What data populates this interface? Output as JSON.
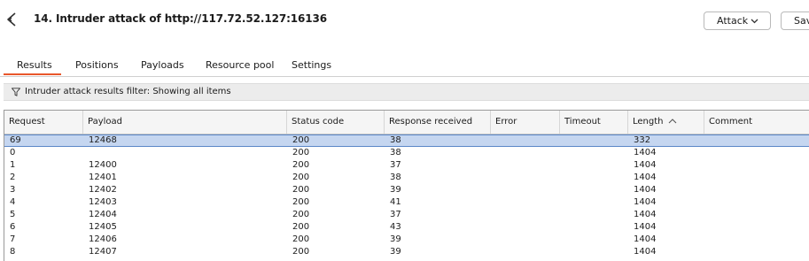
{
  "window": {
    "title": "14. Intruder attack of http://117.72.52.127:16136"
  },
  "toolbar": {
    "attack_label": "Attack",
    "save_label": "Sav"
  },
  "tabs": [
    {
      "label": "Results",
      "active": true
    },
    {
      "label": "Positions"
    },
    {
      "label": "Payloads"
    },
    {
      "label": "Resource pool"
    },
    {
      "label": "Settings"
    }
  ],
  "filter": {
    "text": "Intruder attack results filter: Showing all items"
  },
  "table": {
    "columns": [
      "Request",
      "Payload",
      "Status code",
      "Response received",
      "Error",
      "Timeout",
      "Length",
      "Comment"
    ],
    "sorted_column": "Length",
    "rows": [
      {
        "request": "69",
        "payload": "12468",
        "status": "200",
        "received": "38",
        "error": "",
        "timeout": "",
        "length": "332",
        "comment": "",
        "selected": true
      },
      {
        "request": "0",
        "payload": "",
        "status": "200",
        "received": "38",
        "error": "",
        "timeout": "",
        "length": "1404",
        "comment": ""
      },
      {
        "request": "1",
        "payload": "12400",
        "status": "200",
        "received": "37",
        "error": "",
        "timeout": "",
        "length": "1404",
        "comment": ""
      },
      {
        "request": "2",
        "payload": "12401",
        "status": "200",
        "received": "38",
        "error": "",
        "timeout": "",
        "length": "1404",
        "comment": ""
      },
      {
        "request": "3",
        "payload": "12402",
        "status": "200",
        "received": "39",
        "error": "",
        "timeout": "",
        "length": "1404",
        "comment": ""
      },
      {
        "request": "4",
        "payload": "12403",
        "status": "200",
        "received": "41",
        "error": "",
        "timeout": "",
        "length": "1404",
        "comment": ""
      },
      {
        "request": "5",
        "payload": "12404",
        "status": "200",
        "received": "37",
        "error": "",
        "timeout": "",
        "length": "1404",
        "comment": ""
      },
      {
        "request": "6",
        "payload": "12405",
        "status": "200",
        "received": "43",
        "error": "",
        "timeout": "",
        "length": "1404",
        "comment": ""
      },
      {
        "request": "7",
        "payload": "12406",
        "status": "200",
        "received": "39",
        "error": "",
        "timeout": "",
        "length": "1404",
        "comment": ""
      },
      {
        "request": "8",
        "payload": "12407",
        "status": "200",
        "received": "39",
        "error": "",
        "timeout": "",
        "length": "1404",
        "comment": ""
      }
    ]
  },
  "colors": {
    "accent": "#e8572b",
    "selection": "#c5d6f0",
    "selection_border": "#5b87c7"
  },
  "icons": {
    "app": "burp-intruder-icon",
    "attack_menu": "chevron-down-icon",
    "filter": "filter-funnel-icon",
    "sort": "sort-ascending-icon"
  }
}
